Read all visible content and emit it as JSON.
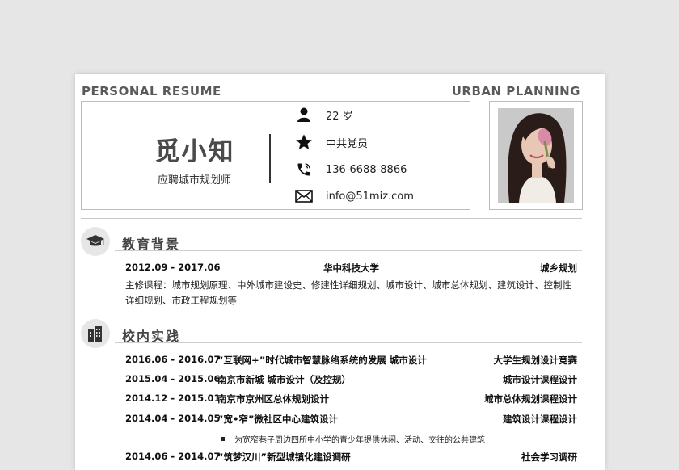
{
  "header": {
    "left_tag": "PERSONAL RESUME",
    "right_tag": "URBAN PLANNING"
  },
  "profile": {
    "name": "觅小知",
    "position": "应聘城市规划师",
    "contacts": [
      {
        "icon": "person-icon",
        "text": "22 岁"
      },
      {
        "icon": "star-icon",
        "text": "中共党员"
      },
      {
        "icon": "phone-icon",
        "text": "136-6688-8866"
      },
      {
        "icon": "mail-icon",
        "text": "info@51miz.com"
      }
    ]
  },
  "education": {
    "title": "教育背景",
    "icon": "graduation-cap-icon",
    "period": "2012.09 - 2017.06",
    "school": "华中科技大学",
    "major": "城乡规划",
    "courses": "主修课程：城市规划原理、中外城市建设史、修建性详细规划、城市设计、城市总体规划、建筑设计、控制性详细规划、市政工程规划等"
  },
  "practice": {
    "title": "校内实践",
    "icon": "buildings-icon",
    "items": [
      {
        "period": "2016.06 - 2016.07",
        "name": "“互联网+”时代城市智慧脉络系统的发展  城市设计",
        "tag": "大学生规划设计竞赛"
      },
      {
        "period": "2015.04 - 2015.06",
        "name": "南京市新城  城市设计（及控规）",
        "tag": "城市设计课程设计"
      },
      {
        "period": "2014.12 - 2015.01",
        "name": "南京市京州区总体规划设计",
        "tag": "城市总体规划课程设计"
      },
      {
        "period": "2014.04 - 2014.05",
        "name": "“宽•窄”微社区中心建筑设计",
        "tag": "建筑设计课程设计"
      },
      {
        "period": "2014.06 - 2014.07",
        "name": "“筑梦汉川”新型城镇化建设调研",
        "tag": "社会学习调研"
      }
    ],
    "bullet": "为宽窄巷子周边四所中小学的青少年提供休闲、活动、交往的公共建筑"
  },
  "colors": {
    "background": "#e6e6e6",
    "paper": "#ffffff",
    "heading": "#444444"
  }
}
